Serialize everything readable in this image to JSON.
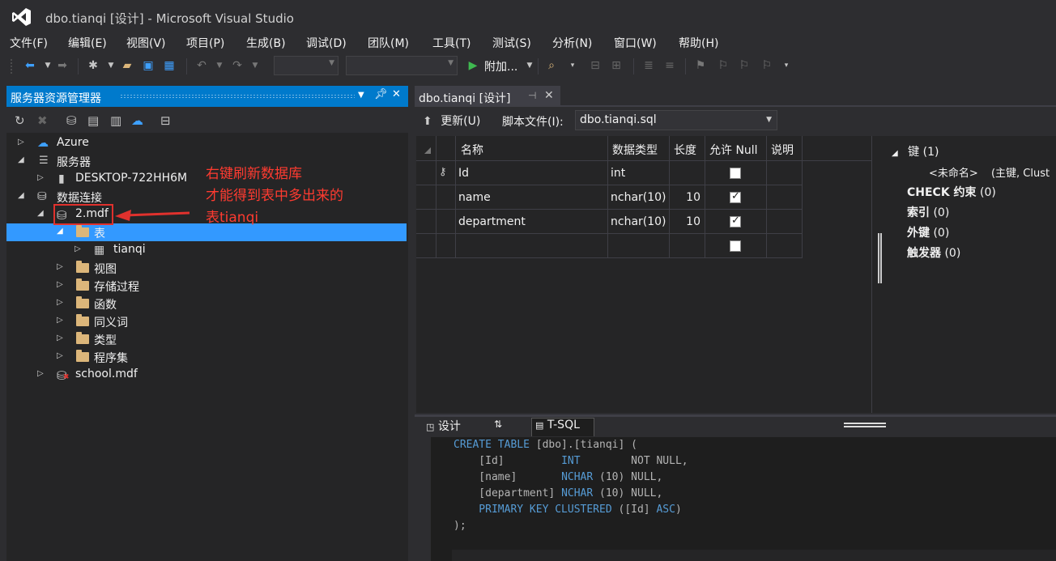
{
  "window": {
    "title": "dbo.tianqi [设计] - Microsoft Visual Studio"
  },
  "menu": [
    "文件(F)",
    "编辑(E)",
    "视图(V)",
    "项目(P)",
    "生成(B)",
    "调试(D)",
    "团队(M)",
    "工具(T)",
    "测试(S)",
    "分析(N)",
    "窗口(W)",
    "帮助(H)"
  ],
  "toolbar": {
    "attach_label": "附加..."
  },
  "server_explorer": {
    "title": "服务器资源管理器",
    "tree": {
      "azure": "Azure",
      "servers": "服务器",
      "desktop": "DESKTOP-722HH6M",
      "data_connections": "数据连接",
      "db": "2.mdf",
      "tables": "表",
      "table_tianqi": "tianqi",
      "views": "视图",
      "procs": "存储过程",
      "functions": "函数",
      "synonyms": "同义词",
      "types": "类型",
      "assemblies": "程序集",
      "school": "school.mdf"
    }
  },
  "annotation": {
    "line1": "右键刷新数据库",
    "line2": "才能得到表中多出来的",
    "line3": "表tianqi",
    "color": "#ff3b30"
  },
  "document_tab": {
    "label": "dbo.tianqi [设计]"
  },
  "designer": {
    "update_label": "更新(U)",
    "script_label": "脚本文件(I):",
    "script_file": "dbo.tianqi.sql",
    "columns": {
      "name": "名称",
      "type": "数据类型",
      "length": "长度",
      "allow_null": "允许 Null",
      "desc": "说明"
    },
    "rows": [
      {
        "name": "Id",
        "type": "int",
        "length": "",
        "allow_null": false,
        "pk": true
      },
      {
        "name": "name",
        "type": "nchar(10)",
        "length": "10",
        "allow_null": true,
        "pk": false
      },
      {
        "name": "department",
        "type": "nchar(10)",
        "length": "10",
        "allow_null": true,
        "pk": false
      },
      {
        "name": "",
        "type": "",
        "length": "",
        "allow_null": false,
        "pk": false
      }
    ]
  },
  "keys": {
    "keys_label": "键",
    "keys_count": "(1)",
    "unnamed": "<未命名>",
    "pk_desc": "(主键, Clust",
    "check_label": "CHECK 约束",
    "check_count": "(0)",
    "index_label": "索引",
    "index_count": "(0)",
    "fk_label": "外键",
    "fk_count": "(0)",
    "trigger_label": "触发器",
    "trigger_count": "(0)"
  },
  "pane_tabs": {
    "design": "设计",
    "tsql": "T-SQL"
  },
  "sql": {
    "l1_kw": "CREATE TABLE",
    "l1_rest": " [dbo].[tianqi] (",
    "l2_col": "    [Id]         ",
    "l2_type": "INT",
    "l2_rest": "        NOT NULL,",
    "l3_col": "    [name]       ",
    "l3_type": "NCHAR",
    "l3_rest": " (10) NULL,",
    "l4_col": "    [department] ",
    "l4_type": "NCHAR",
    "l4_rest": " (10) NULL,",
    "l5_kw": "    PRIMARY KEY CLUSTERED",
    "l5_mid": " ([Id] ",
    "l5_asc": "ASC",
    "l5_end": ")",
    "l6": ");"
  }
}
